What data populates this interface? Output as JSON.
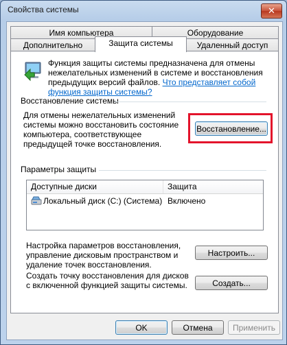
{
  "window": {
    "title": "Свойства системы",
    "close_glyph": "✕"
  },
  "tabs": {
    "row_back": [
      "Имя компьютера",
      "Оборудование"
    ],
    "row_front": [
      "Дополнительно",
      "Защита системы",
      "Удаленный доступ"
    ],
    "active": "Защита системы"
  },
  "description": {
    "text": "Функция защиты системы предназначена для отмены нежелательных изменений в системе и восстановления предыдущих версий файлов.",
    "link": "Что представляет собой функция защиты системы?"
  },
  "restore_group": {
    "title": "Восстановление системы",
    "text": "Для отмены нежелательных изменений системы можно восстановить состояние компьютера, соответствующее предыдущей точке восстановления.",
    "button": "Восстановление..."
  },
  "protection_group": {
    "title": "Параметры защиты",
    "columns": [
      "Доступные диски",
      "Защита"
    ],
    "rows": [
      {
        "disk": "Локальный диск (C:) (Система)",
        "status": "Включено",
        "icon": "drive-icon"
      }
    ],
    "configure_text": "Настройка параметров восстановления, управление дисковым пространством и удаление точек восстановления.",
    "configure_button": "Настроить...",
    "create_text": "Создать точку восстановления для дисков с включенной функцией защиты системы.",
    "create_button": "Создать..."
  },
  "footer": {
    "ok": "OK",
    "cancel": "Отмена",
    "apply": "Применить"
  },
  "colors": {
    "highlight_box": "#e3132b",
    "link": "#0066cc"
  }
}
